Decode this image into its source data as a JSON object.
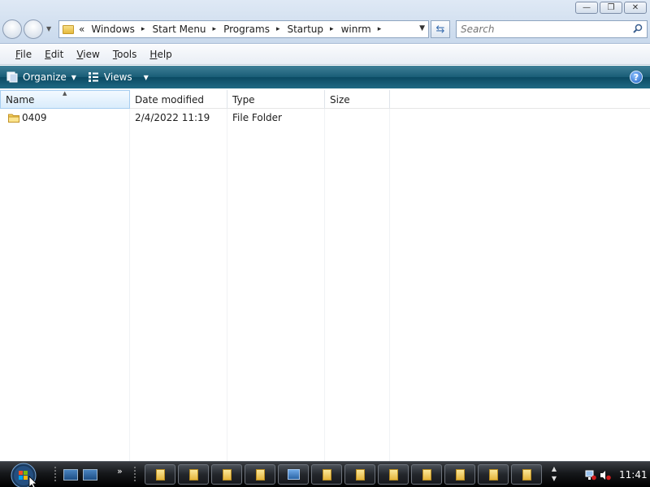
{
  "window": {
    "controls": {
      "minimize": "—",
      "maximize": "❐",
      "close": "✕"
    }
  },
  "address": {
    "overflow": "«",
    "crumbs": [
      "Windows",
      "Start Menu",
      "Programs",
      "Startup",
      "winrm"
    ],
    "separator": "▸"
  },
  "search": {
    "placeholder": "Search"
  },
  "menu": {
    "items": [
      {
        "first": "F",
        "rest": "ile"
      },
      {
        "first": "E",
        "rest": "dit"
      },
      {
        "first": "V",
        "rest": "iew"
      },
      {
        "first": "T",
        "rest": "ools"
      },
      {
        "first": "H",
        "rest": "elp"
      }
    ]
  },
  "commandbar": {
    "organize": "Organize",
    "views": "Views",
    "help": "?"
  },
  "columns": {
    "name": "Name",
    "date": "Date modified",
    "type": "Type",
    "size": "Size"
  },
  "files": [
    {
      "name": "0409",
      "date": "2/4/2022 11:19",
      "type": "File Folder",
      "size": ""
    }
  ],
  "taskbar": {
    "chevron": "»",
    "clock": "11:41"
  }
}
